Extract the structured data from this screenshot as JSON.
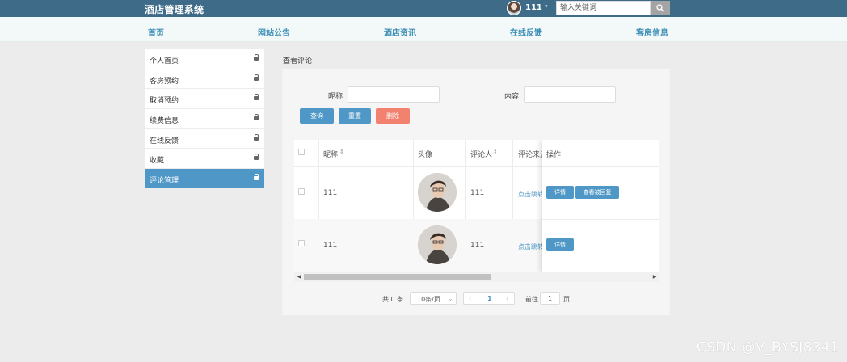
{
  "header": {
    "brand": "酒店管理系统",
    "username": "111",
    "caret": "▾",
    "search_placeholder": "输入关键词"
  },
  "nav": [
    "首页",
    "网站公告",
    "酒店资讯",
    "在线反馈",
    "客房信息"
  ],
  "sidebar": {
    "items": [
      {
        "label": "个人首页"
      },
      {
        "label": "客房预约"
      },
      {
        "label": "取消预约"
      },
      {
        "label": "续费信息"
      },
      {
        "label": "在线反馈"
      },
      {
        "label": "收藏"
      },
      {
        "label": "评论管理",
        "active": true
      }
    ]
  },
  "main": {
    "title": "查看评论",
    "form": {
      "nickname_label": "昵称",
      "content_label": "内容",
      "query_button": "查询",
      "reset_button": "重置",
      "delete_button": "删除"
    },
    "table": {
      "headers": [
        "昵称",
        "头像",
        "评论人",
        "评论来源",
        "操作"
      ],
      "rows": [
        {
          "nickname": "111",
          "commenter": "111",
          "source_link": "点击跳转",
          "actions": [
            "详情",
            "查看被回复"
          ]
        },
        {
          "nickname": "111",
          "commenter": "111",
          "source_link": "点击跳转",
          "actions": [
            "详情"
          ]
        }
      ]
    },
    "pagination": {
      "total": "共 0 条",
      "page_size": "10条/页",
      "current_page": "1",
      "goto_prefix": "前往",
      "goto_value": "1",
      "goto_suffix": "页"
    }
  },
  "watermark": "CSDN @V_BYSJ8341",
  "colors": {
    "topbar": "#3d6b88",
    "accent": "#4f97c6",
    "danger": "#f2826f",
    "nav_text": "#3d8fb8"
  }
}
